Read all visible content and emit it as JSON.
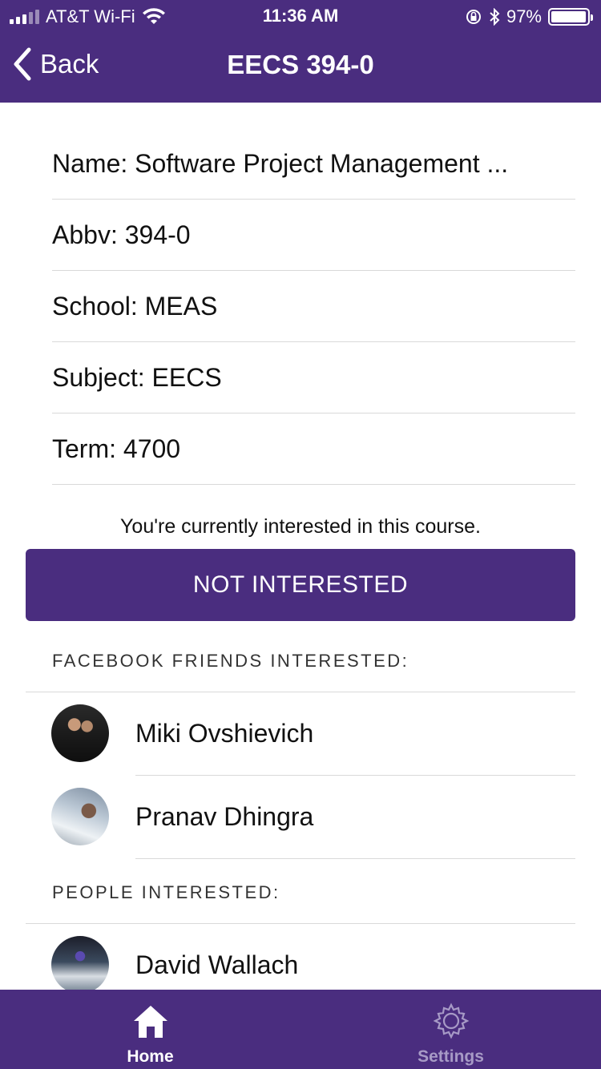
{
  "status_bar": {
    "carrier": "AT&T Wi-Fi",
    "time": "11:36 AM",
    "battery_percent": "97%",
    "battery_level": 0.97
  },
  "nav": {
    "back_label": "Back",
    "title": "EECS 394-0"
  },
  "course": {
    "name": "Name: Software Project Management ...",
    "abbv": "Abbv: 394-0",
    "school": "School: MEAS",
    "subject": "Subject: EECS",
    "term": "Term: 4700"
  },
  "interest": {
    "note": "You're currently interested in this course.",
    "button_label": "NOT INTERESTED"
  },
  "friends_section": {
    "header": "FACEBOOK FRIENDS INTERESTED:",
    "people": [
      {
        "name": "Miki Ovshievich"
      },
      {
        "name": "Pranav Dhingra"
      }
    ]
  },
  "people_section": {
    "header": "PEOPLE INTERESTED:",
    "people": [
      {
        "name": "David Wallach"
      }
    ]
  },
  "tabbar": {
    "home_label": "Home",
    "settings_label": "Settings"
  },
  "colors": {
    "brand_purple": "#4a2d7f",
    "inactive_tab": "#a79ac6"
  },
  "icons": [
    "signal-icon",
    "wifi-icon",
    "orientation-lock-icon",
    "bluetooth-icon",
    "battery-icon",
    "chevron-left-icon",
    "home-icon",
    "gear-icon"
  ]
}
